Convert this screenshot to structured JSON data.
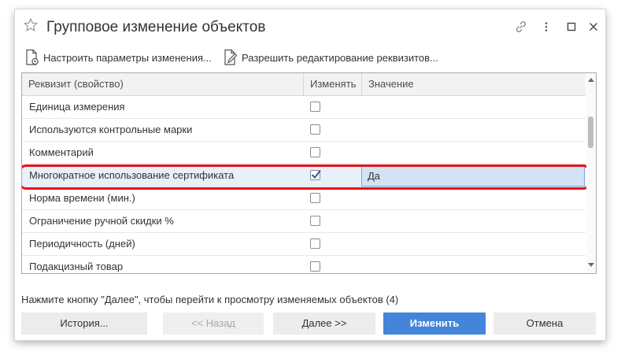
{
  "window": {
    "title": "Групповое изменение объектов",
    "icons": [
      "star-icon",
      "link-icon",
      "more-icon",
      "maximize-icon",
      "close-icon"
    ]
  },
  "toolbar": {
    "configure_label": "Настроить параметры изменения...",
    "allow_edit_label": "Разрешить редактирование реквизитов..."
  },
  "table": {
    "columns": {
      "attribute": "Реквизит (свойство)",
      "change": "Изменять",
      "value": "Значение"
    },
    "rows": [
      {
        "name": "Единица измерения",
        "checked": false,
        "value": ""
      },
      {
        "name": "Используются контрольные марки",
        "checked": false,
        "value": ""
      },
      {
        "name": "Комментарий",
        "checked": false,
        "value": ""
      },
      {
        "name": "Многократное использование сертификата",
        "checked": true,
        "value": "Да",
        "selected": true
      },
      {
        "name": "Норма времени (мин.)",
        "checked": false,
        "value": ""
      },
      {
        "name": "Ограничение ручной скидки %",
        "checked": false,
        "value": ""
      },
      {
        "name": "Периодичность (дней)",
        "checked": false,
        "value": ""
      },
      {
        "name": "Подакцизный товар",
        "checked": false,
        "value": ""
      }
    ]
  },
  "hint": "Нажмите кнопку \"Далее\", чтобы перейти к просмотру изменяемых объектов (4)",
  "buttons": {
    "history": "История...",
    "back": "<<   Назад",
    "next": "Далее   >>",
    "apply": "Изменить",
    "cancel": "Отмена"
  },
  "colors": {
    "accent": "#4285d9",
    "highlight_ring": "#e8121a",
    "selected_value_bg": "#d3e3f6"
  }
}
